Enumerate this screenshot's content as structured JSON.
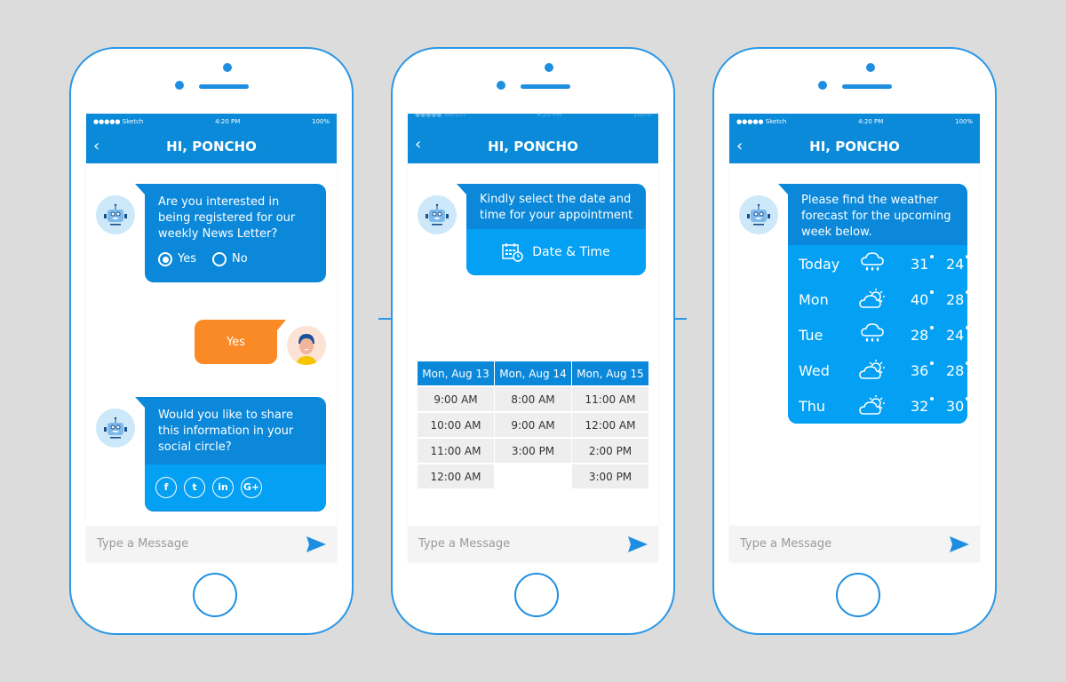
{
  "status": {
    "carrier": "●●●●● Sketch",
    "time": "4:20 PM",
    "battery": "100%"
  },
  "header": {
    "title": "HI, PONCHO",
    "back": "‹"
  },
  "input": {
    "placeholder": "Type a Message"
  },
  "colors": {
    "primary": "#0a8ad8",
    "bubble": "#0b88d9",
    "bubble_light": "#03a0f4",
    "user_bubble": "#f98a25"
  },
  "screen1": {
    "q1": "Are you interested in being registered for our weekly News Letter?",
    "options": [
      "Yes",
      "No"
    ],
    "selected": "Yes",
    "reply": "Yes",
    "q2": "Would you like to share this information in your social circle?",
    "social": [
      "facebook",
      "twitter",
      "linkedin",
      "google-plus"
    ]
  },
  "screen2": {
    "prompt": "Kindly select the date and time for your appointment",
    "button": "Date & Time",
    "columns": [
      {
        "date": "Mon, Aug 13",
        "times": [
          "9:00 AM",
          "10:00 AM",
          "11:00 AM",
          "12:00 AM"
        ]
      },
      {
        "date": "Mon, Aug 14",
        "times": [
          "8:00 AM",
          "9:00 AM",
          "3:00 PM",
          ""
        ]
      },
      {
        "date": "Mon, Aug 15",
        "times": [
          "11:00 AM",
          "12:00 AM",
          "2:00 PM",
          "3:00 PM"
        ]
      }
    ]
  },
  "screen3": {
    "message": "Please find the weather forecast for the upcoming week below.",
    "forecast": [
      {
        "day": "Today",
        "icon": "rain-cloud-icon",
        "high": "31",
        "low": "24"
      },
      {
        "day": "Mon",
        "icon": "partly-sunny-icon",
        "high": "40",
        "low": "28"
      },
      {
        "day": "Tue",
        "icon": "rain-cloud-icon",
        "high": "28",
        "low": "24"
      },
      {
        "day": "Wed",
        "icon": "partly-sunny-icon",
        "high": "36",
        "low": "28"
      },
      {
        "day": "Thu",
        "icon": "partly-sunny-icon",
        "high": "32",
        "low": "30"
      }
    ]
  }
}
